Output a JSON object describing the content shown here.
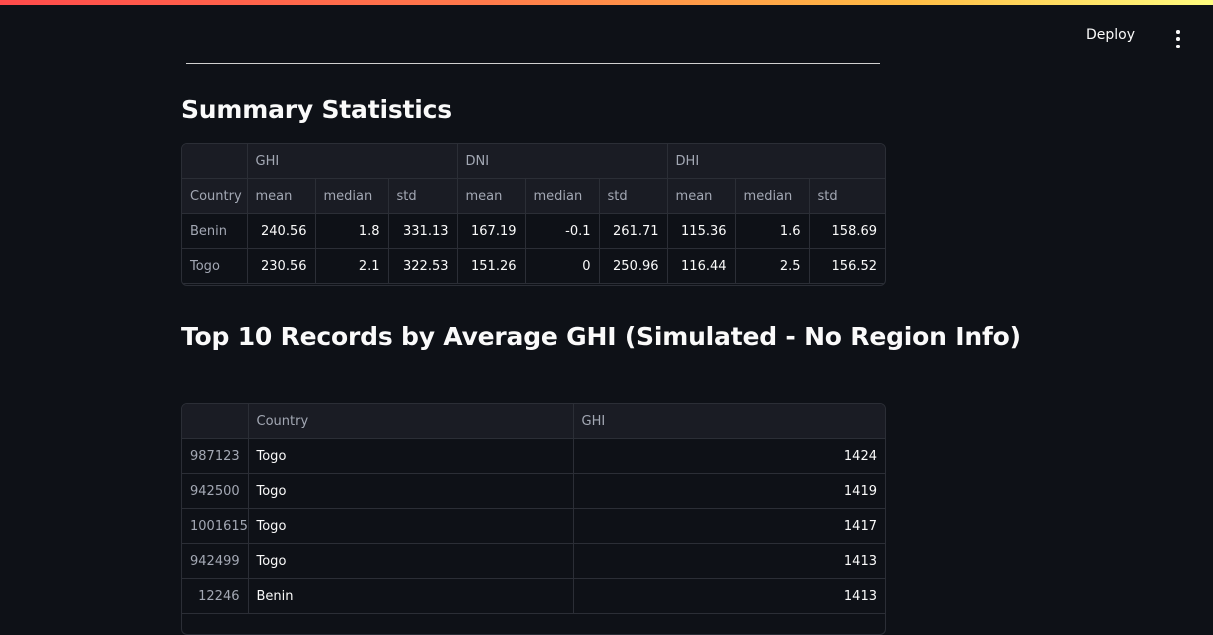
{
  "header": {
    "deploy_label": "Deploy"
  },
  "summary": {
    "title": "Summary Statistics",
    "groups": [
      "GHI",
      "DNI",
      "DHI"
    ],
    "index_label": "Country",
    "stat_headers": [
      "mean",
      "median",
      "std",
      "mean",
      "median",
      "std",
      "mean",
      "median",
      "std"
    ],
    "rows": [
      {
        "country": "Benin",
        "values": [
          "240.56",
          "1.8",
          "331.13",
          "167.19",
          "-0.1",
          "261.71",
          "115.36",
          "1.6",
          "158.69"
        ]
      },
      {
        "country": "Togo",
        "values": [
          "230.56",
          "2.1",
          "322.53",
          "151.26",
          "0",
          "250.96",
          "116.44",
          "2.5",
          "156.52"
        ]
      }
    ]
  },
  "top": {
    "title": "Top 10 Records by Average GHI (Simulated - No Region Info)",
    "columns": [
      "Country",
      "GHI"
    ],
    "rows": [
      {
        "index": "987123",
        "country": "Togo",
        "ghi": "1424"
      },
      {
        "index": "942500",
        "country": "Togo",
        "ghi": "1419"
      },
      {
        "index": "1001615",
        "country": "Togo",
        "ghi": "1417"
      },
      {
        "index": "942499",
        "country": "Togo",
        "ghi": "1413"
      },
      {
        "index": "12246",
        "country": "Benin",
        "ghi": "1413"
      }
    ]
  }
}
